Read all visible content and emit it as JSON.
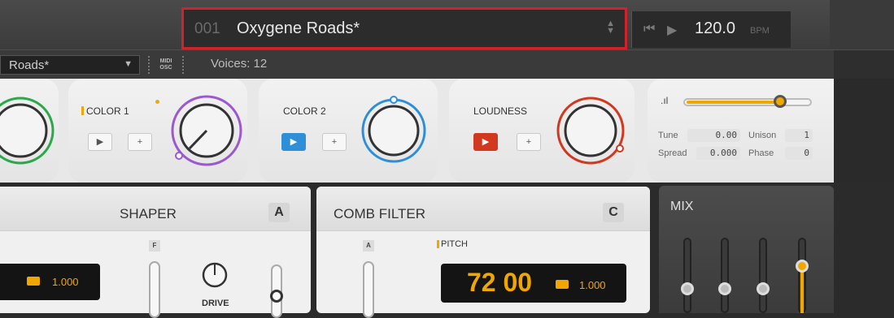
{
  "topbar": {
    "preset_number": "001",
    "preset_name": "Oxygene Roads*",
    "tempo_value": "120.0",
    "tempo_unit": "BPM"
  },
  "secondbar": {
    "preset_dropdown_label": "Roads*",
    "midi_label": "MIDI",
    "osc_label": "OSC",
    "voices_label": "Voices: 12"
  },
  "oscillators": {
    "color1_title": "COLOR 1",
    "color2_title": "COLOR 2",
    "loudness_title": "LOUDNESS",
    "play_glyph": "▶",
    "plus_glyph": "+"
  },
  "params": {
    "tune_label": "Tune",
    "tune_value": "0.00",
    "unison_label": "Unison",
    "unison_value": "1",
    "spread_label": "Spread",
    "spread_value": "0.000",
    "phase_label": "Phase",
    "phase_value": "0",
    "level_fraction": 0.78
  },
  "shaper": {
    "title": "SHAPER",
    "badge": "A",
    "f_badge": "F",
    "drive_label": "DRIVE",
    "lcd_value": "1.000"
  },
  "comb": {
    "title": "COMB FILTER",
    "badge": "C",
    "a_badge": "A",
    "pitch_label": "PITCH",
    "lcd_big": "72 00",
    "lcd_value": "1.000"
  },
  "mix": {
    "title": "MIX"
  },
  "colors": {
    "highlight_red": "#d0222a",
    "accent_green": "#2aa84a",
    "accent_purple": "#9b59d0",
    "accent_blue": "#2e8fd8",
    "accent_red": "#d0391f",
    "accent_orange": "#f0a800"
  }
}
